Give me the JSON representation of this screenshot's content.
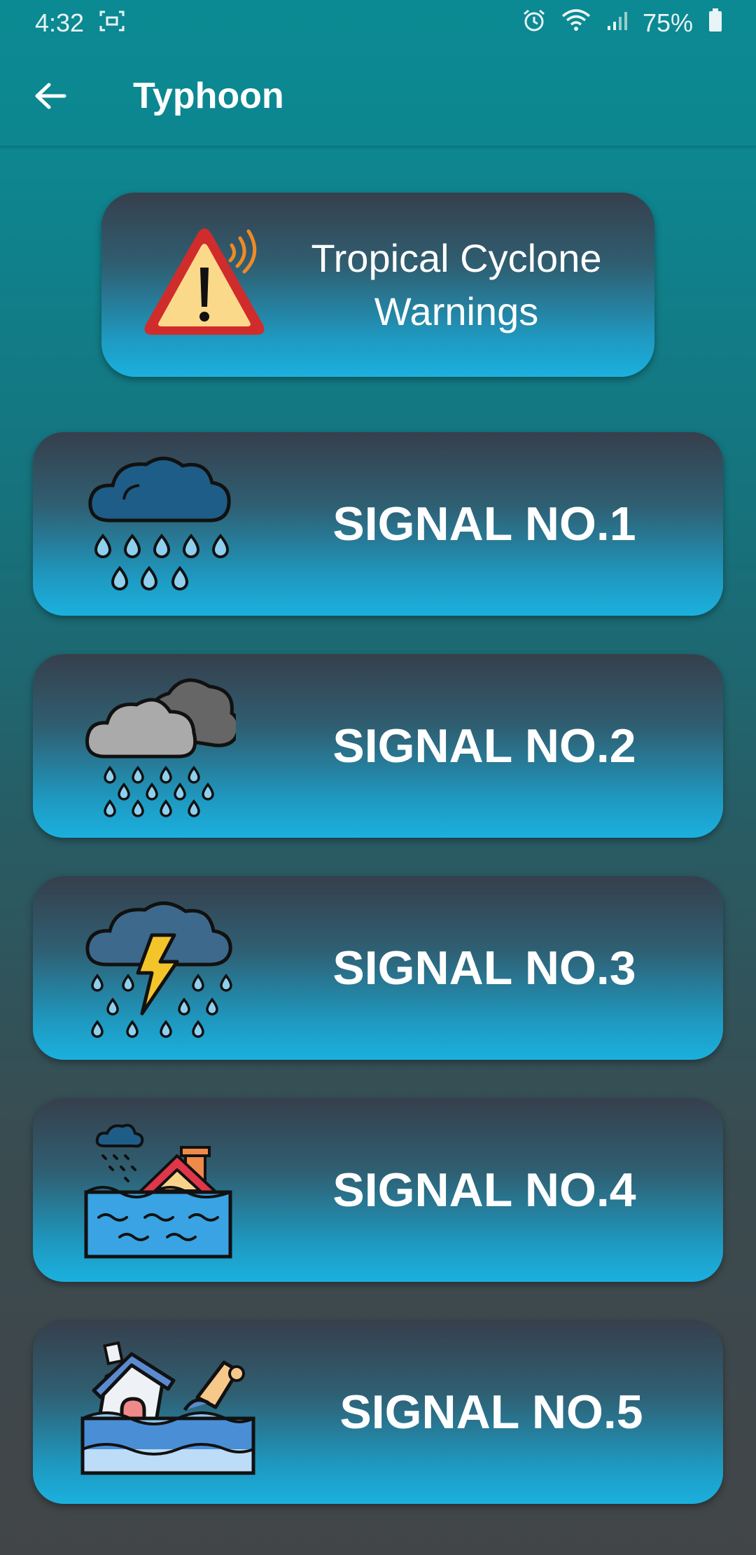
{
  "status_bar": {
    "time": "4:32",
    "battery": "75%",
    "icons": [
      "screenshot-icon",
      "alarm-icon",
      "wifi-icon",
      "signal-icon",
      "battery-icon"
    ]
  },
  "app_bar": {
    "title": "Typhoon",
    "back_icon": "arrow-left-icon"
  },
  "warning_card": {
    "label": "Tropical Cyclone Warnings",
    "icon": "warning-triangle-icon"
  },
  "signals": [
    {
      "label": "SIGNAL NO.1",
      "icon": "rain-cloud-icon"
    },
    {
      "label": "SIGNAL NO.2",
      "icon": "heavy-rain-clouds-icon"
    },
    {
      "label": "SIGNAL NO.3",
      "icon": "thunderstorm-icon"
    },
    {
      "label": "SIGNAL NO.4",
      "icon": "flooded-house-icon"
    },
    {
      "label": "SIGNAL NO.5",
      "icon": "flood-destruction-icon"
    }
  ],
  "colors": {
    "app_bar": "#0b8a93",
    "card_top": "#363f4c",
    "card_bottom": "#1bb0de",
    "text": "#ffffff"
  }
}
